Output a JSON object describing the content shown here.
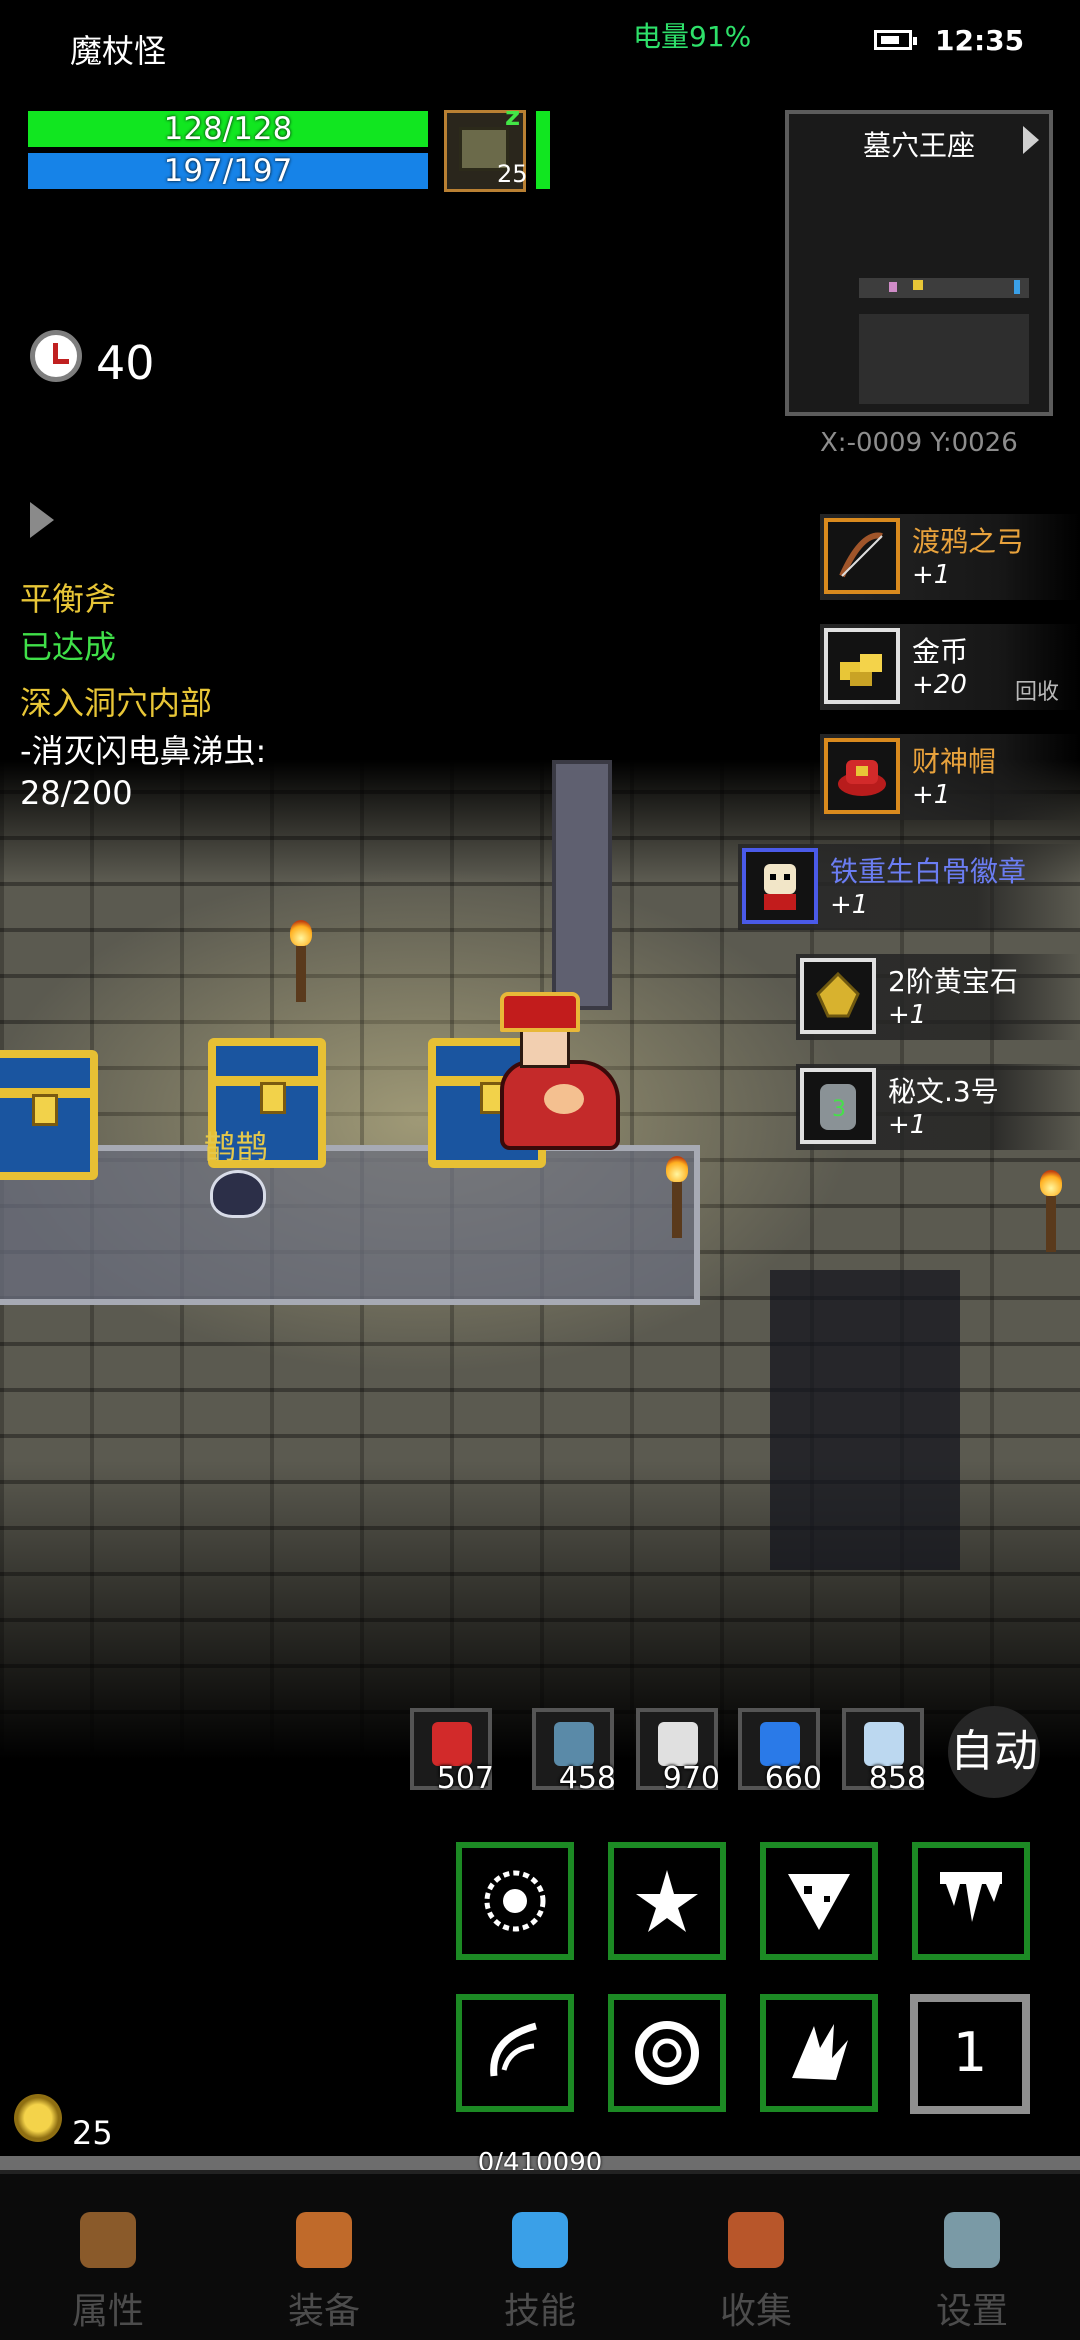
{
  "status": {
    "title": "魔杖怪",
    "battery": "电量91%",
    "time": "12:35"
  },
  "player": {
    "hp": "128/128",
    "mp": "197/197",
    "pet_level": "25",
    "pet_status": "z"
  },
  "minimap": {
    "title": "墓穴王座",
    "coords": "X:-0009  Y:0026"
  },
  "timer": {
    "value": "40"
  },
  "quest": {
    "achievement_name": "平衡斧",
    "achievement_status": "已达成",
    "mission_title": "深入洞穴内部",
    "mission_objective": "-消灭闪电鼻涕虫:",
    "mission_progress": "28/200"
  },
  "loot": [
    {
      "name": "渡鸦之弓",
      "qty": "+1",
      "color": "#e8a23c",
      "border": "#d98a1e"
    },
    {
      "name": "金币",
      "qty": "+20",
      "color": "#ffffff",
      "border": "#e0e0e0",
      "extra": "回收"
    },
    {
      "name": "财神帽",
      "qty": "+1",
      "color": "#e8a23c",
      "border": "#d98a1e"
    },
    {
      "name": "铁重生白骨徽章",
      "qty": "+1",
      "color": "#6b7df2",
      "border": "#4a5ae8"
    },
    {
      "name": "2阶黄宝石",
      "qty": "+1",
      "color": "#ffffff",
      "border": "#e0e0e0"
    },
    {
      "name": "秘文.3号",
      "qty": "+1",
      "color": "#ffffff",
      "border": "#e0e0e0"
    }
  ],
  "scene": {
    "npc_name": "鹊鹊"
  },
  "quick_items": [
    {
      "icon": "potion-icon",
      "count": "507"
    },
    {
      "icon": "fish-icon",
      "count": "458"
    },
    {
      "icon": "hp-potion-icon",
      "count": "970"
    },
    {
      "icon": "blue-fish-icon",
      "count": "660"
    },
    {
      "icon": "mp-potion-icon",
      "count": "858"
    }
  ],
  "auto_label": "自动",
  "skills": [
    {
      "icon": "burst-orb-icon"
    },
    {
      "icon": "shatter-star-icon"
    },
    {
      "icon": "ice-shard-icon"
    },
    {
      "icon": "icicle-rain-icon"
    },
    {
      "icon": "wind-slash-icon"
    },
    {
      "icon": "ring-seal-icon"
    },
    {
      "icon": "flame-claw-icon"
    }
  ],
  "skill_slot_number": "1",
  "gold": "25",
  "xp": "0/410090",
  "nav": [
    {
      "label": "属性",
      "icon": "helmet-icon"
    },
    {
      "label": "装备",
      "icon": "bag-icon"
    },
    {
      "label": "技能",
      "icon": "skill-gem-icon"
    },
    {
      "label": "收集",
      "icon": "chest-icon"
    },
    {
      "label": "设置",
      "icon": "gear-icon"
    }
  ],
  "colors": {
    "hp": "#11e620",
    "mp": "#1683e8",
    "quest_yellow": "#e8c637",
    "quest_green": "#40e049",
    "skill_border": "#1c8a24"
  }
}
